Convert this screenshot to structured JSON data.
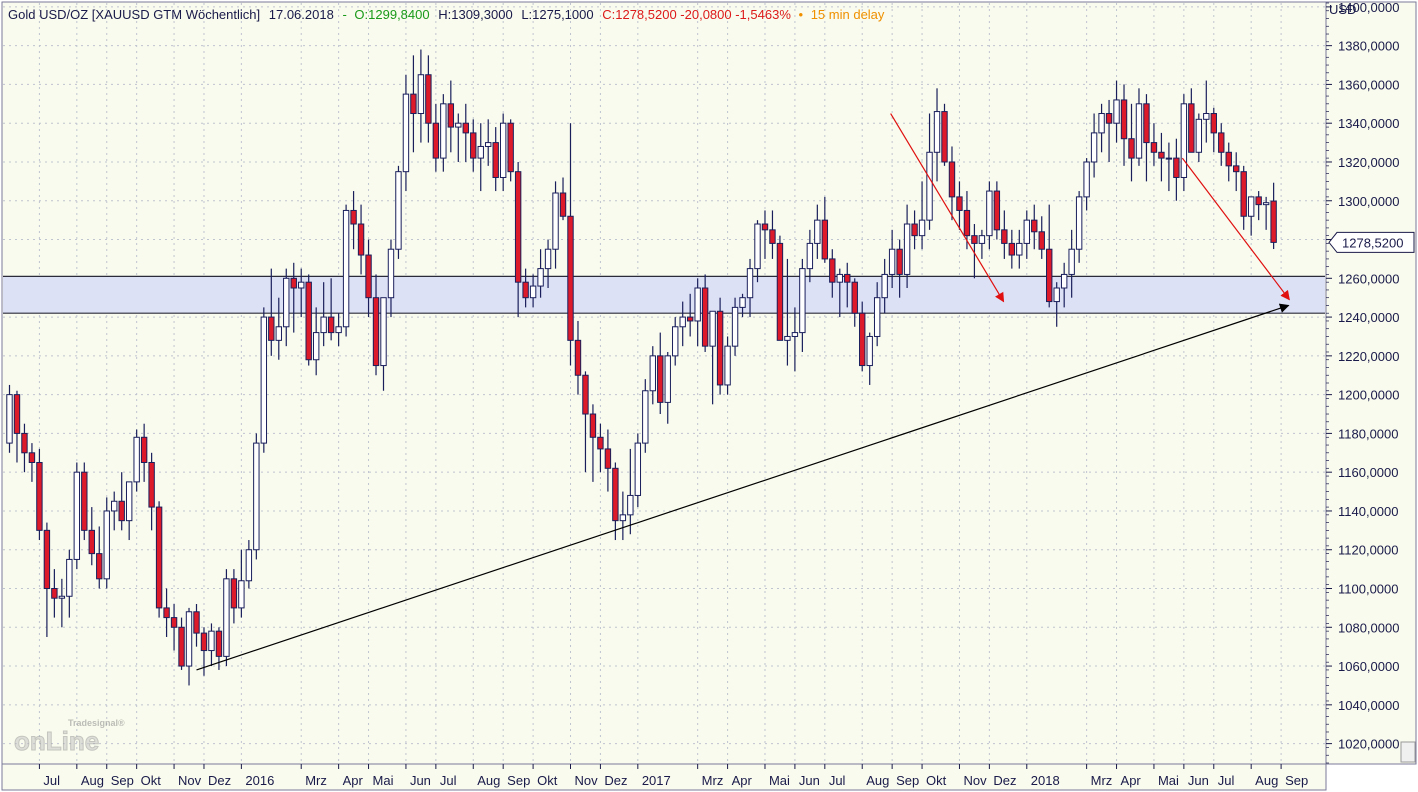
{
  "header": {
    "instrument": "Gold USD/OZ [XAUUSD GTM Wöchentlich]",
    "date": "17.06.2018",
    "open_label": "O:1299,8400",
    "high_label": "H:1309,3000",
    "low_label": "L:1275,1000",
    "close_label": "C:1278,5200 -20,0800 -1,5463%",
    "delay_label": "15 min delay"
  },
  "currency_label": "USD",
  "last_price_label": "1278,5200",
  "watermark": {
    "top": "Tradesignal®",
    "main": "onLine"
  },
  "colors": {
    "background": "#f8fbed",
    "up_body": "#ffffff",
    "down_body": "#dd1a2a",
    "wick": "#1a1f5c",
    "band_fill": "#dde1f5",
    "trendline": "#000000",
    "arrow_red": "#e01010",
    "header_green": "#1a9a1a",
    "header_red": "#dd1a1a",
    "header_orange": "#f09000"
  },
  "chart_data": {
    "type": "candlestick",
    "frequency": "weekly",
    "ylabel": "USD",
    "ylim": [
      1010,
      1402
    ],
    "y_ticks": [
      {
        "value": 1020,
        "label": "1020,0000"
      },
      {
        "value": 1040,
        "label": "1040,0000"
      },
      {
        "value": 1060,
        "label": "1060,0000"
      },
      {
        "value": 1080,
        "label": "1080,0000"
      },
      {
        "value": 1100,
        "label": "1100,0000"
      },
      {
        "value": 1120,
        "label": "1120,0000"
      },
      {
        "value": 1140,
        "label": "1140,0000"
      },
      {
        "value": 1160,
        "label": "1160,0000"
      },
      {
        "value": 1180,
        "label": "1180,0000"
      },
      {
        "value": 1200,
        "label": "1200,0000"
      },
      {
        "value": 1220,
        "label": "1220,0000"
      },
      {
        "value": 1240,
        "label": "1240,0000"
      },
      {
        "value": 1260,
        "label": "1260,0000"
      },
      {
        "value": 1280,
        "label": "1280,0000"
      },
      {
        "value": 1300,
        "label": "1300,0000"
      },
      {
        "value": 1320,
        "label": "1320,0000"
      },
      {
        "value": 1340,
        "label": "1340,0000"
      },
      {
        "value": 1360,
        "label": "1360,0000"
      },
      {
        "value": 1380,
        "label": "1380,0000"
      },
      {
        "value": 1400,
        "label": "1400,0000"
      }
    ],
    "x_labels": [
      {
        "bar": 4,
        "label": "Jul"
      },
      {
        "bar": 9,
        "label": "Aug"
      },
      {
        "bar": 13,
        "label": "Sep"
      },
      {
        "bar": 17,
        "label": "Okt"
      },
      {
        "bar": 22,
        "label": "Nov"
      },
      {
        "bar": 26,
        "label": "Dez"
      },
      {
        "bar": 31,
        "label": "2016"
      },
      {
        "bar": 39,
        "label": "Mrz"
      },
      {
        "bar": 44,
        "label": "Apr"
      },
      {
        "bar": 48,
        "label": "Mai"
      },
      {
        "bar": 53,
        "label": "Jun"
      },
      {
        "bar": 57,
        "label": "Jul"
      },
      {
        "bar": 62,
        "label": "Aug"
      },
      {
        "bar": 66,
        "label": "Sep"
      },
      {
        "bar": 70,
        "label": "Okt"
      },
      {
        "bar": 75,
        "label": "Nov"
      },
      {
        "bar": 79,
        "label": "Dez"
      },
      {
        "bar": 84,
        "label": "2017"
      },
      {
        "bar": 92,
        "label": "Mrz"
      },
      {
        "bar": 96,
        "label": "Apr"
      },
      {
        "bar": 101,
        "label": "Mai"
      },
      {
        "bar": 105,
        "label": "Jun"
      },
      {
        "bar": 109,
        "label": "Jul"
      },
      {
        "bar": 114,
        "label": "Aug"
      },
      {
        "bar": 118,
        "label": "Sep"
      },
      {
        "bar": 122,
        "label": "Okt"
      },
      {
        "bar": 127,
        "label": "Nov"
      },
      {
        "bar": 131,
        "label": "Dez"
      },
      {
        "bar": 136,
        "label": "2018"
      },
      {
        "bar": 144,
        "label": "Mrz"
      },
      {
        "bar": 148,
        "label": "Apr"
      },
      {
        "bar": 153,
        "label": "Mai"
      },
      {
        "bar": 157,
        "label": "Jun"
      },
      {
        "bar": 161,
        "label": "Jul"
      },
      {
        "bar": 166,
        "label": "Aug"
      },
      {
        "bar": 170,
        "label": "Sep"
      }
    ],
    "candles": [
      [
        1175,
        1205,
        1170,
        1200
      ],
      [
        1200,
        1202,
        1165,
        1180
      ],
      [
        1180,
        1185,
        1160,
        1170
      ],
      [
        1170,
        1175,
        1155,
        1165
      ],
      [
        1165,
        1172,
        1125,
        1130
      ],
      [
        1130,
        1134,
        1075,
        1100
      ],
      [
        1100,
        1110,
        1085,
        1095
      ],
      [
        1095,
        1105,
        1080,
        1096
      ],
      [
        1096,
        1120,
        1085,
        1115
      ],
      [
        1115,
        1165,
        1110,
        1160
      ],
      [
        1160,
        1165,
        1125,
        1130
      ],
      [
        1130,
        1142,
        1112,
        1118
      ],
      [
        1118,
        1132,
        1100,
        1105
      ],
      [
        1105,
        1147,
        1100,
        1140
      ],
      [
        1140,
        1150,
        1130,
        1145
      ],
      [
        1145,
        1160,
        1130,
        1135
      ],
      [
        1135,
        1155,
        1125,
        1155
      ],
      [
        1155,
        1182,
        1150,
        1178
      ],
      [
        1178,
        1185,
        1155,
        1165
      ],
      [
        1165,
        1170,
        1130,
        1142
      ],
      [
        1142,
        1145,
        1085,
        1090
      ],
      [
        1090,
        1100,
        1075,
        1085
      ],
      [
        1085,
        1092,
        1068,
        1080
      ],
      [
        1080,
        1085,
        1058,
        1060
      ],
      [
        1060,
        1090,
        1050,
        1088
      ],
      [
        1088,
        1092,
        1070,
        1077
      ],
      [
        1077,
        1080,
        1055,
        1068
      ],
      [
        1068,
        1082,
        1060,
        1078
      ],
      [
        1078,
        1080,
        1058,
        1065
      ],
      [
        1065,
        1110,
        1060,
        1105
      ],
      [
        1105,
        1110,
        1082,
        1090
      ],
      [
        1090,
        1120,
        1085,
        1104
      ],
      [
        1104,
        1125,
        1100,
        1120
      ],
      [
        1120,
        1180,
        1115,
        1175
      ],
      [
        1175,
        1245,
        1170,
        1240
      ],
      [
        1240,
        1265,
        1220,
        1228
      ],
      [
        1228,
        1250,
        1218,
        1235
      ],
      [
        1235,
        1265,
        1225,
        1260
      ],
      [
        1260,
        1268,
        1232,
        1255
      ],
      [
        1255,
        1265,
        1240,
        1258
      ],
      [
        1258,
        1262,
        1215,
        1218
      ],
      [
        1218,
        1245,
        1210,
        1232
      ],
      [
        1232,
        1258,
        1225,
        1240
      ],
      [
        1240,
        1260,
        1228,
        1232
      ],
      [
        1232,
        1242,
        1225,
        1235
      ],
      [
        1235,
        1298,
        1230,
        1295
      ],
      [
        1295,
        1305,
        1275,
        1288
      ],
      [
        1288,
        1298,
        1262,
        1272
      ],
      [
        1272,
        1280,
        1240,
        1250
      ],
      [
        1250,
        1262,
        1210,
        1215
      ],
      [
        1215,
        1250,
        1202,
        1250
      ],
      [
        1250,
        1280,
        1240,
        1275
      ],
      [
        1275,
        1318,
        1270,
        1315
      ],
      [
        1315,
        1365,
        1305,
        1355
      ],
      [
        1355,
        1375,
        1325,
        1345
      ],
      [
        1345,
        1378,
        1330,
        1365
      ],
      [
        1365,
        1375,
        1330,
        1340
      ],
      [
        1340,
        1350,
        1315,
        1322
      ],
      [
        1322,
        1355,
        1315,
        1350
      ],
      [
        1350,
        1362,
        1325,
        1338
      ],
      [
        1338,
        1345,
        1320,
        1340
      ],
      [
        1340,
        1350,
        1320,
        1335
      ],
      [
        1335,
        1342,
        1315,
        1322
      ],
      [
        1322,
        1340,
        1305,
        1328
      ],
      [
        1328,
        1342,
        1318,
        1330
      ],
      [
        1330,
        1338,
        1305,
        1312
      ],
      [
        1312,
        1345,
        1305,
        1340
      ],
      [
        1340,
        1342,
        1310,
        1315
      ],
      [
        1315,
        1320,
        1240,
        1258
      ],
      [
        1258,
        1265,
        1245,
        1250
      ],
      [
        1250,
        1262,
        1245,
        1256
      ],
      [
        1256,
        1275,
        1250,
        1265
      ],
      [
        1265,
        1280,
        1255,
        1275
      ],
      [
        1275,
        1310,
        1265,
        1304
      ],
      [
        1304,
        1312,
        1290,
        1292
      ],
      [
        1292,
        1340,
        1215,
        1228
      ],
      [
        1228,
        1238,
        1200,
        1210
      ],
      [
        1210,
        1212,
        1160,
        1190
      ],
      [
        1190,
        1195,
        1155,
        1178
      ],
      [
        1178,
        1185,
        1160,
        1172
      ],
      [
        1172,
        1182,
        1150,
        1162
      ],
      [
        1162,
        1165,
        1125,
        1135
      ],
      [
        1135,
        1150,
        1125,
        1138
      ],
      [
        1138,
        1172,
        1128,
        1148
      ],
      [
        1148,
        1180,
        1142,
        1175
      ],
      [
        1175,
        1208,
        1170,
        1202
      ],
      [
        1202,
        1225,
        1195,
        1220
      ],
      [
        1220,
        1232,
        1190,
        1196
      ],
      [
        1196,
        1222,
        1185,
        1220
      ],
      [
        1220,
        1240,
        1215,
        1235
      ],
      [
        1235,
        1248,
        1225,
        1240
      ],
      [
        1240,
        1252,
        1230,
        1238
      ],
      [
        1238,
        1260,
        1225,
        1255
      ],
      [
        1255,
        1262,
        1222,
        1225
      ],
      [
        1225,
        1235,
        1195,
        1243
      ],
      [
        1243,
        1250,
        1200,
        1205
      ],
      [
        1205,
        1230,
        1200,
        1225
      ],
      [
        1225,
        1250,
        1220,
        1245
      ],
      [
        1245,
        1252,
        1240,
        1250
      ],
      [
        1250,
        1270,
        1240,
        1265
      ],
      [
        1265,
        1290,
        1258,
        1288
      ],
      [
        1288,
        1295,
        1270,
        1285
      ],
      [
        1285,
        1295,
        1270,
        1278
      ],
      [
        1278,
        1282,
        1230,
        1228
      ],
      [
        1228,
        1270,
        1215,
        1230
      ],
      [
        1230,
        1245,
        1212,
        1232
      ],
      [
        1232,
        1270,
        1222,
        1265
      ],
      [
        1265,
        1285,
        1258,
        1278
      ],
      [
        1278,
        1298,
        1270,
        1290
      ],
      [
        1290,
        1302,
        1268,
        1270
      ],
      [
        1270,
        1275,
        1250,
        1258
      ],
      [
        1258,
        1265,
        1240,
        1262
      ],
      [
        1262,
        1268,
        1245,
        1258
      ],
      [
        1258,
        1260,
        1235,
        1242
      ],
      [
        1242,
        1248,
        1212,
        1215
      ],
      [
        1215,
        1232,
        1205,
        1230
      ],
      [
        1230,
        1258,
        1225,
        1250
      ],
      [
        1250,
        1270,
        1242,
        1262
      ],
      [
        1262,
        1285,
        1255,
        1275
      ],
      [
        1275,
        1280,
        1250,
        1262
      ],
      [
        1262,
        1298,
        1255,
        1288
      ],
      [
        1288,
        1295,
        1275,
        1282
      ],
      [
        1282,
        1310,
        1275,
        1290
      ],
      [
        1290,
        1345,
        1285,
        1325
      ],
      [
        1325,
        1358,
        1310,
        1346
      ],
      [
        1346,
        1350,
        1318,
        1320
      ],
      [
        1320,
        1328,
        1290,
        1302
      ],
      [
        1302,
        1310,
        1285,
        1295
      ],
      [
        1295,
        1305,
        1275,
        1282
      ],
      [
        1282,
        1288,
        1260,
        1278
      ],
      [
        1278,
        1285,
        1270,
        1282
      ],
      [
        1282,
        1310,
        1275,
        1305
      ],
      [
        1305,
        1310,
        1280,
        1285
      ],
      [
        1285,
        1295,
        1270,
        1278
      ],
      [
        1278,
        1285,
        1265,
        1272
      ],
      [
        1272,
        1285,
        1265,
        1278
      ],
      [
        1278,
        1295,
        1270,
        1290
      ],
      [
        1290,
        1298,
        1275,
        1284
      ],
      [
        1284,
        1292,
        1270,
        1275
      ],
      [
        1275,
        1298,
        1245,
        1248
      ],
      [
        1248,
        1258,
        1235,
        1255
      ],
      [
        1255,
        1268,
        1245,
        1262
      ],
      [
        1262,
        1285,
        1250,
        1275
      ],
      [
        1275,
        1305,
        1268,
        1302
      ],
      [
        1302,
        1322,
        1295,
        1320
      ],
      [
        1320,
        1345,
        1312,
        1335
      ],
      [
        1335,
        1350,
        1325,
        1345
      ],
      [
        1345,
        1352,
        1320,
        1340
      ],
      [
        1340,
        1362,
        1330,
        1352
      ],
      [
        1352,
        1360,
        1318,
        1332
      ],
      [
        1332,
        1350,
        1310,
        1322
      ],
      [
        1322,
        1358,
        1318,
        1350
      ],
      [
        1350,
        1355,
        1310,
        1330
      ],
      [
        1330,
        1340,
        1318,
        1325
      ],
      [
        1325,
        1335,
        1310,
        1322
      ],
      [
        1322,
        1330,
        1305,
        1322
      ],
      [
        1322,
        1332,
        1300,
        1312
      ],
      [
        1312,
        1355,
        1305,
        1350
      ],
      [
        1350,
        1358,
        1325,
        1325
      ],
      [
        1325,
        1345,
        1320,
        1342
      ],
      [
        1342,
        1362,
        1330,
        1345
      ],
      [
        1345,
        1348,
        1325,
        1335
      ],
      [
        1335,
        1340,
        1318,
        1325
      ],
      [
        1325,
        1330,
        1310,
        1318
      ],
      [
        1318,
        1325,
        1305,
        1315
      ],
      [
        1315,
        1318,
        1285,
        1292
      ],
      [
        1292,
        1302,
        1282,
        1302
      ],
      [
        1302,
        1305,
        1290,
        1298
      ],
      [
        1298,
        1302,
        1285,
        1299
      ],
      [
        1299.84,
        1309.3,
        1275.1,
        1278.52
      ]
    ],
    "support_band": [
      1242,
      1261
    ],
    "trendline": {
      "from_bar": 25,
      "from_price": 1058,
      "to_bar": 171,
      "to_price": 1246
    },
    "arrows_red": [
      {
        "from_bar": 117.8,
        "from_price": 1345,
        "to_bar": 132.9,
        "to_price": 1248
      },
      {
        "from_bar": 156.8,
        "from_price": 1322,
        "to_bar": 171.1,
        "to_price": 1249
      }
    ]
  }
}
